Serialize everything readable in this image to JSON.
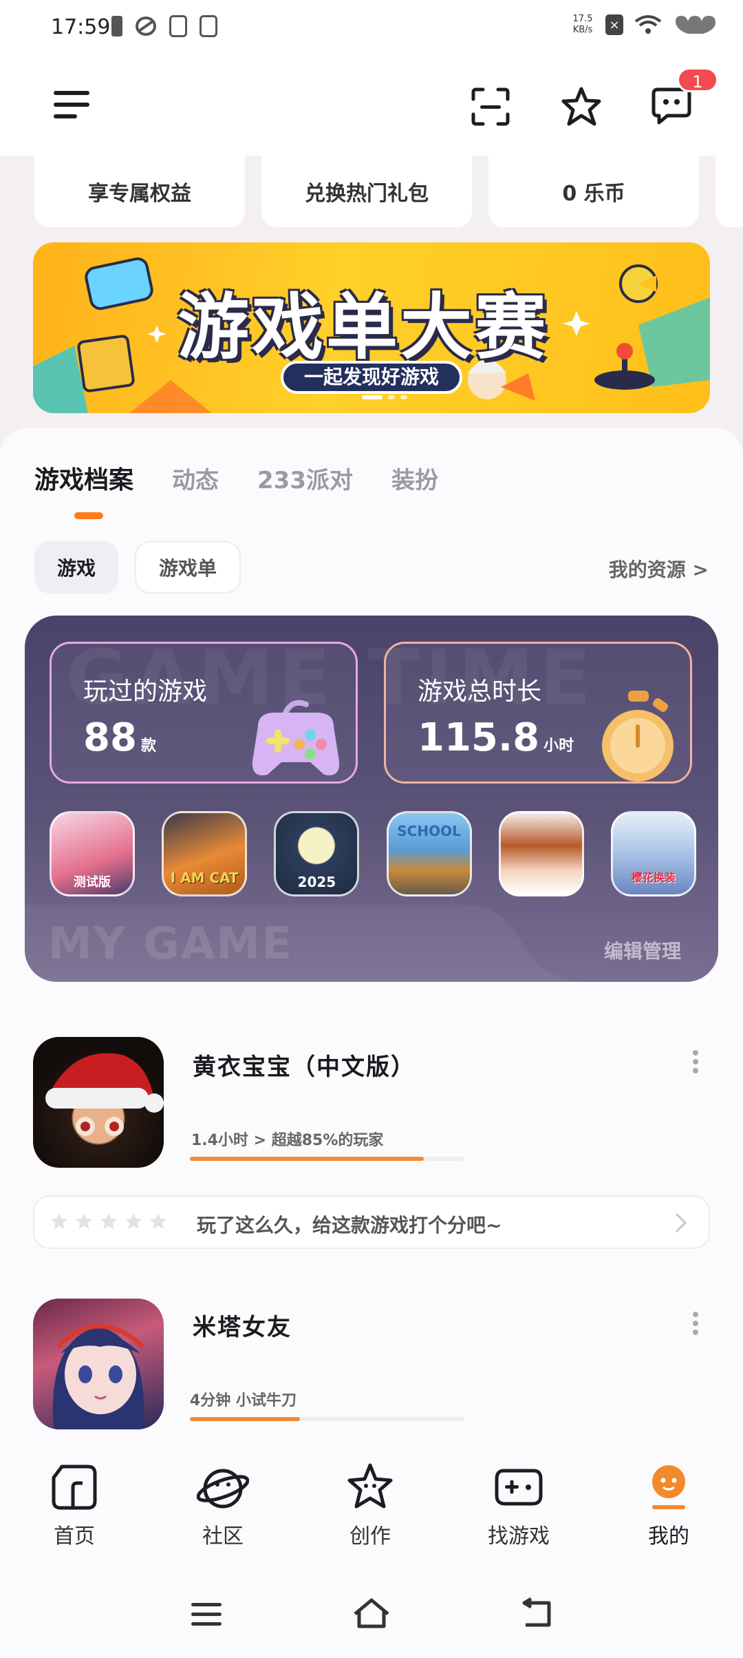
{
  "status_bar": {
    "time": "17:59",
    "net_speed_value": "17.5",
    "net_speed_unit": "KB/s",
    "sim_label": "×",
    "battery_level": 0.6
  },
  "header": {
    "message_badge": "1"
  },
  "benefits": [
    {
      "label": "享专属权益"
    },
    {
      "label": "兑换热门礼包"
    },
    {
      "label": "0 乐币"
    }
  ],
  "banner": {
    "title": "游戏单大赛",
    "subtitle": "一起发现好游戏"
  },
  "tabs": [
    {
      "label": "游戏档案",
      "active": true
    },
    {
      "label": "动态",
      "active": false
    },
    {
      "label": "233派对",
      "active": false
    },
    {
      "label": "装扮",
      "active": false
    }
  ],
  "filters": {
    "games_label": "游戏",
    "gamelist_label": "游戏单",
    "my_resources": "我的资源 >"
  },
  "game_time": {
    "bg_text": "GAME TIME",
    "played_label": "玩过的游戏",
    "played_count": "88",
    "played_unit": "款",
    "total_label": "游戏总时长",
    "total_hours": "115.8",
    "total_unit": "小时",
    "bottom_text": "MY GAME",
    "edit_label": "编辑管理",
    "thumb_captions": [
      "测试版",
      "I AM CAT",
      "2025",
      "SCHOOL",
      "",
      "樱花换装"
    ]
  },
  "games": [
    {
      "name": "黄衣宝宝（中文版）",
      "meta": "1.4小时 > 超越85%的玩家",
      "progress": 0.85
    },
    {
      "name": "米塔女友",
      "meta": "4分钟 小试牛刀",
      "progress": 0.4
    }
  ],
  "rating": {
    "prompt": "玩了这么久，给这款游戏打个分吧~",
    "stars": 0
  },
  "bottom_nav": [
    {
      "label": "首页",
      "icon": "home-icon"
    },
    {
      "label": "社区",
      "icon": "community-icon"
    },
    {
      "label": "创作",
      "icon": "create-icon"
    },
    {
      "label": "找游戏",
      "icon": "find-game-icon"
    },
    {
      "label": "我的",
      "icon": "profile-icon",
      "active": true
    }
  ],
  "colors": {
    "accent": "#ff7a1a",
    "badge": "#f24a4f",
    "card_dark": "#4a4369"
  }
}
